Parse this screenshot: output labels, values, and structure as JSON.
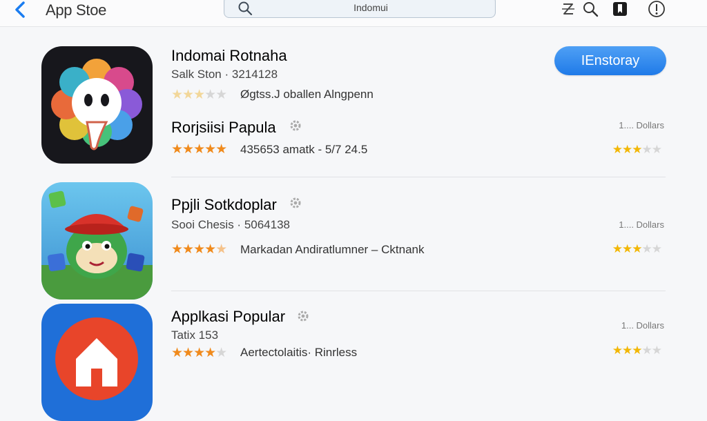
{
  "header": {
    "title": "App Stoe",
    "search_value": "Indomui",
    "icons": [
      "back-chevron-icon",
      "search-icon",
      "zigzag-icon",
      "magnifier-icon",
      "bookmark-icon",
      "info-icon"
    ]
  },
  "featured": {
    "name": "Indomai Rotnaha",
    "subtitle": "Salk Ston · 3214128",
    "description": "Øgtss.J oballen Alngpenn",
    "install_label": "IEnstoray",
    "rating_stars": 3,
    "accent_color": "#1f7ae8"
  },
  "apps": [
    {
      "name": "Rorjsiisi Papula",
      "subtitle": "",
      "rating_text": "435653 amatk - 5/7 24.5",
      "rating_stars": 5,
      "price": "1.... Dollars",
      "right_stars": 3
    },
    {
      "name": "Ppjli Sotkdoplar",
      "subtitle": "Sooi Chesis · 5064138",
      "rating_text": "Markadan Andiratlumner – Cktnank",
      "rating_stars": 4,
      "price": "1.... Dollars",
      "right_stars": 3
    },
    {
      "name": "Applkasi Popular",
      "subtitle": "Tatix 153",
      "rating_text": "Aertectolaitis· Rinrless",
      "rating_stars": 4,
      "price": "1... Dollars",
      "right_stars": 3
    }
  ],
  "colors": {
    "accent": "#1f7ae8",
    "star": "#f08a1c",
    "star_right": "#f2b705"
  }
}
